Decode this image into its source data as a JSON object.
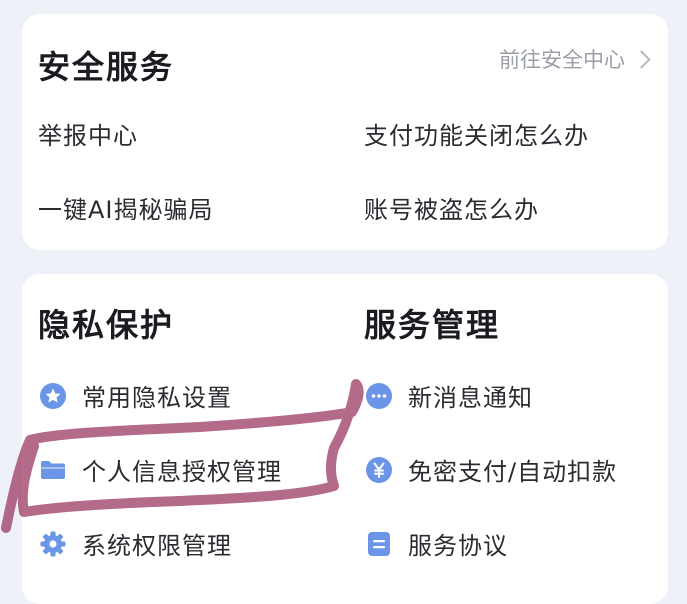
{
  "security": {
    "title": "安全服务",
    "link_label": "前往安全中心",
    "items": [
      {
        "label": "举报中心"
      },
      {
        "label": "支付功能关闭怎么办"
      },
      {
        "label": "一键AI揭秘骗局"
      },
      {
        "label": "账号被盗怎么办"
      }
    ]
  },
  "privacy": {
    "title": "隐私保护",
    "items": [
      {
        "label": "常用隐私设置",
        "icon": "star-icon"
      },
      {
        "label": "个人信息授权管理",
        "icon": "folder-icon"
      },
      {
        "label": "系统权限管理",
        "icon": "gear-icon"
      }
    ]
  },
  "service_mgmt": {
    "title": "服务管理",
    "items": [
      {
        "label": "新消息通知",
        "icon": "message-dots-icon"
      },
      {
        "label": "免密支付/自动扣款",
        "icon": "yuan-icon"
      },
      {
        "label": "服务协议",
        "icon": "document-icon"
      }
    ]
  },
  "colors": {
    "icon_blue": "#6b95e6",
    "scribble": "#a4496f"
  }
}
